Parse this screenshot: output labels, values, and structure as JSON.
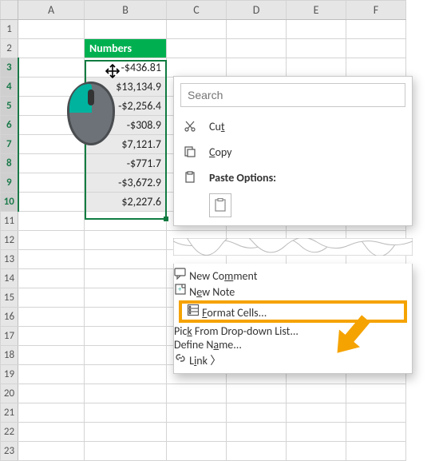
{
  "columnHeaders": [
    "A",
    "B",
    "C",
    "D",
    "E",
    "F"
  ],
  "cells": {
    "header": "Numbers",
    "values": [
      "-$436.81",
      "$13,134.9",
      "-$2,256.4",
      "-$308.9",
      "$7,121.7",
      "-$771.7",
      "-$3,672.9",
      "$2,227.6"
    ]
  },
  "selectedRows": [
    3,
    10
  ],
  "contextMenu": {
    "searchPlaceholder": "Search",
    "cut": "Cut",
    "copy": "Copy",
    "pasteOptions": "Paste Options:"
  },
  "contextMenu2": {
    "newComment": "New Comment",
    "newNote": "New Note",
    "formatCells": "Format Cells...",
    "pickFrom": "Pick From Drop-down List...",
    "defineName": "Define Name...",
    "link": "Link"
  }
}
